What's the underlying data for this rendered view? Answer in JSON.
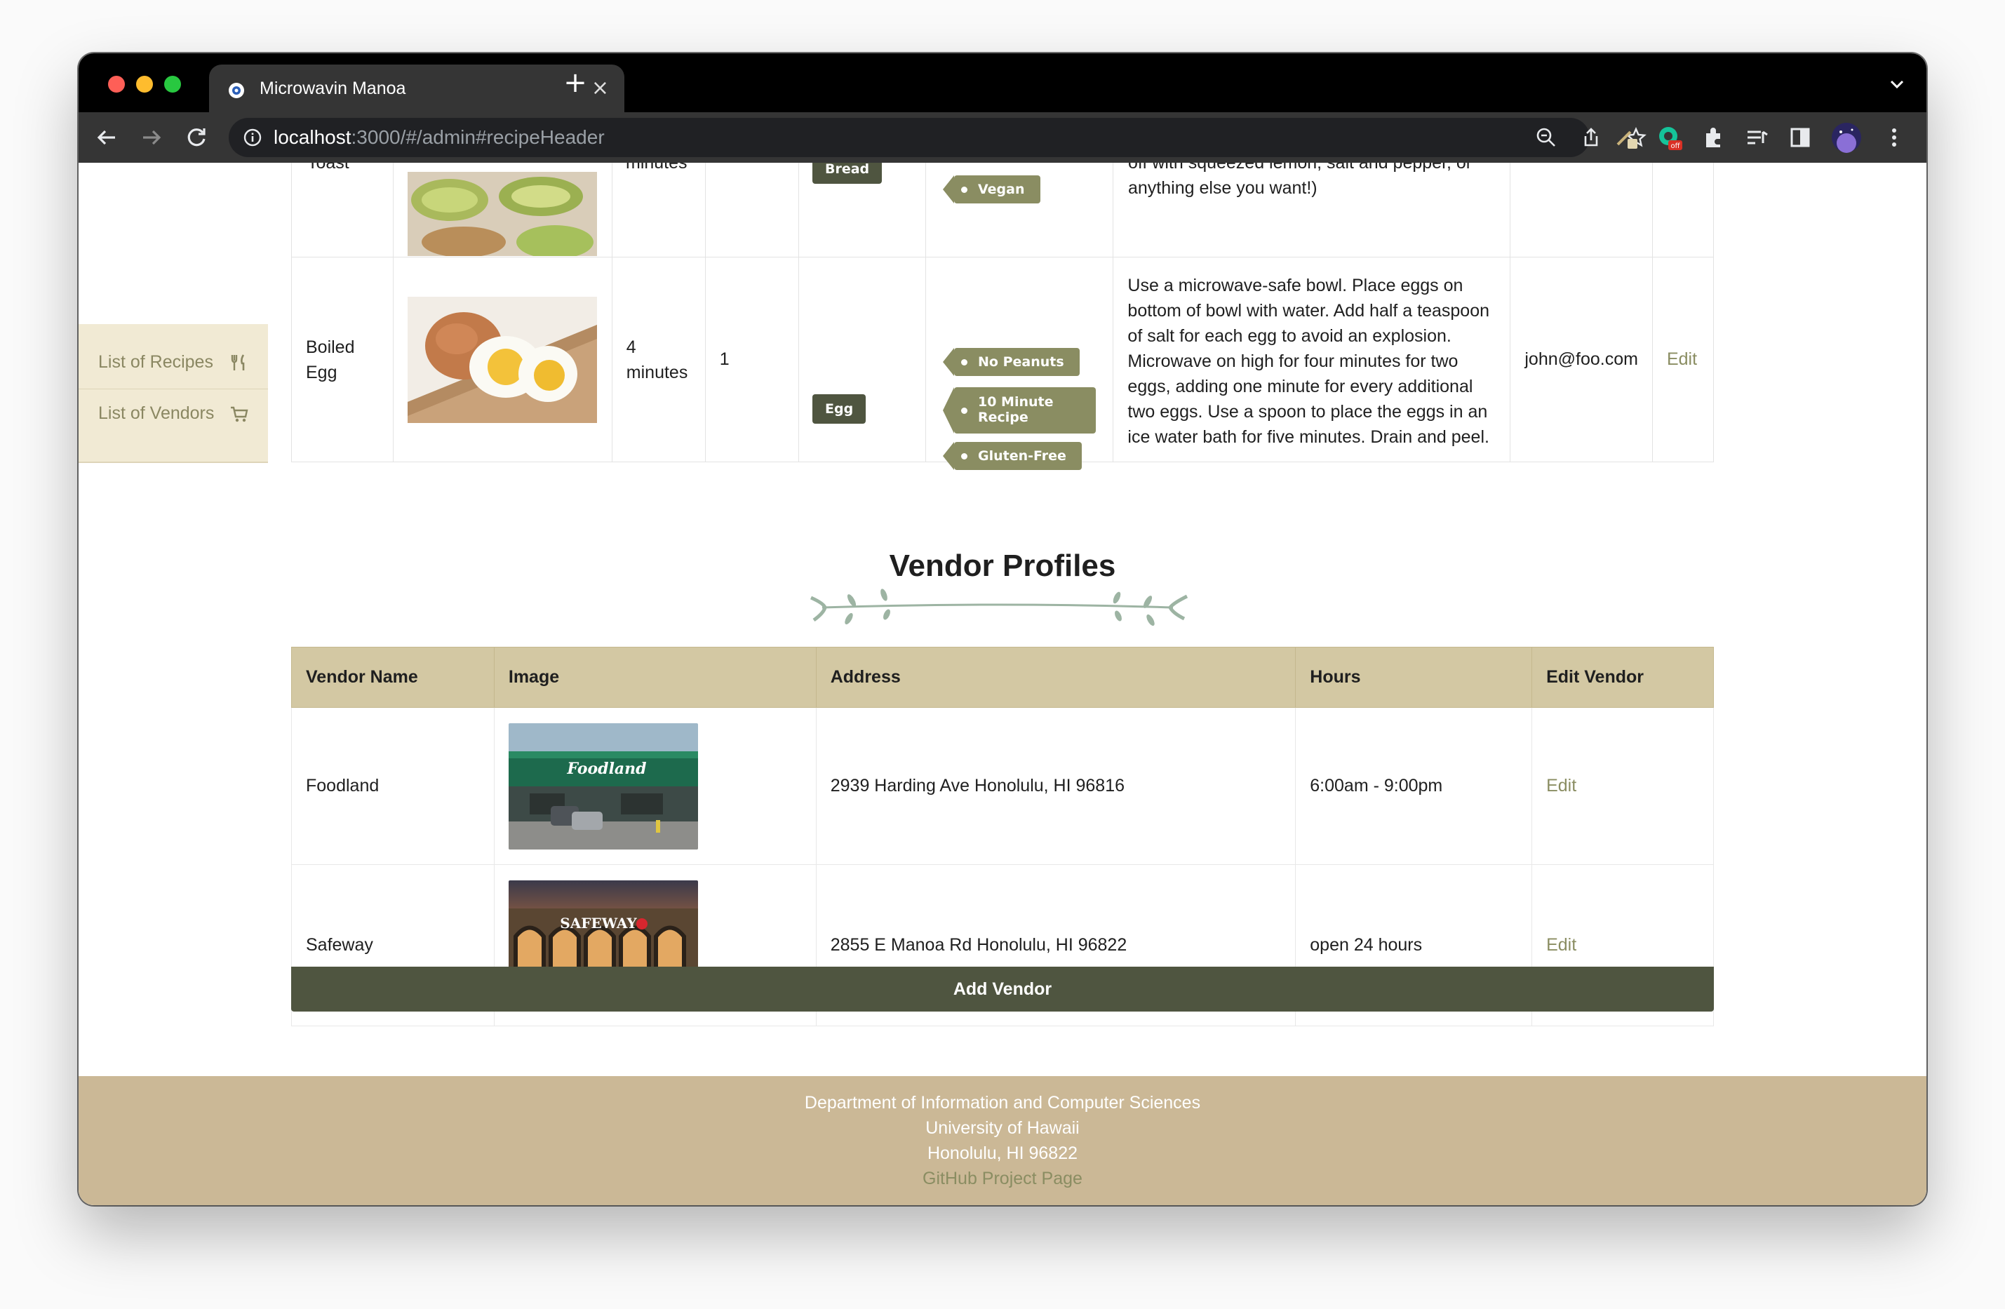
{
  "browser": {
    "tab_title": "Microwavin Manoa",
    "url_host": "localhost",
    "url_rest": ":3000/#/admin#recipeHeader",
    "extension_badge": "off"
  },
  "sidebar": {
    "items": [
      {
        "label": "List of Recipes",
        "icon": "utensils-icon"
      },
      {
        "label": "List of Vendors",
        "icon": "cart-icon"
      }
    ]
  },
  "recipes_partial": {
    "prev_row": {
      "name_cut": "Toast",
      "time_cut": "minutes",
      "ingredient": "Bread",
      "tag": "Vegan",
      "instructions_cut": "off with squeezed lemon, salt and pepper, or",
      "instructions_end": "anything else you want!)"
    },
    "row": {
      "name": "Boiled Egg",
      "time": "4 minutes",
      "servings": "1",
      "ingredient": "Egg",
      "tags": [
        "No Peanuts",
        "10 Minute Recipe",
        "Gluten-Free"
      ],
      "instructions": "Use a microwave-safe bowl. Place eggs on bottom of bowl with water. Add half a teaspoon of salt for each egg to avoid an explosion. Microwave on high for four minutes for two eggs, adding one minute for every additional two eggs. Use a spoon to place the eggs in an ice water bath for five minutes. Drain and peel.",
      "owner": "john@foo.com",
      "edit": "Edit"
    }
  },
  "vendors": {
    "title": "Vendor Profiles",
    "columns": [
      "Vendor Name",
      "Image",
      "Address",
      "Hours",
      "Edit Vendor"
    ],
    "rows": [
      {
        "name": "Foodland",
        "image_label": "Foodland",
        "address": "2939 Harding Ave Honolulu, HI 96816",
        "hours": "6:00am - 9:00pm",
        "edit": "Edit"
      },
      {
        "name": "Safeway",
        "image_label": "SAFEWAY",
        "address": "2855 E Manoa Rd Honolulu, HI 96822",
        "hours": "open 24 hours",
        "edit": "Edit"
      }
    ],
    "add_button": "Add Vendor"
  },
  "footer": {
    "line1": "Department of Information and Computer Sciences",
    "line2": "University of Hawaii",
    "line3": "Honolulu, HI 96822",
    "link": "GitHub Project Page"
  }
}
